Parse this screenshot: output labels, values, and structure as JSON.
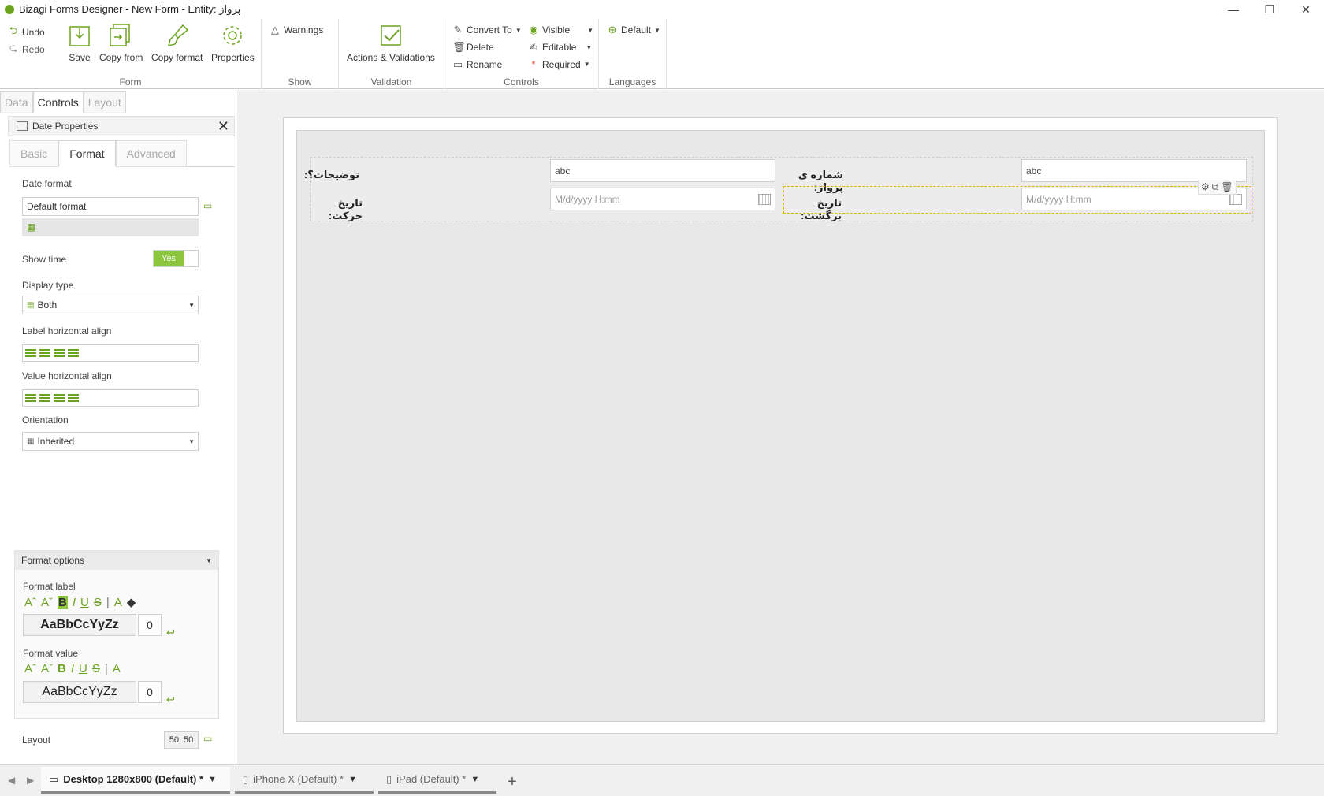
{
  "window": {
    "title": "Bizagi Forms Designer  - New Form - Entity: پرواز",
    "minimize": "—",
    "restore": "❐",
    "close": "✕"
  },
  "ribbon": {
    "form": {
      "undo": "Undo",
      "redo": "Redo",
      "save": "Save",
      "copy_from": "Copy from",
      "copy_format": "Copy format",
      "properties": "Properties",
      "group": "Form"
    },
    "show": {
      "warnings": "Warnings",
      "group": "Show"
    },
    "validation": {
      "actions": "Actions & Validations",
      "group": "Validation"
    },
    "controls": {
      "convert_to": "Convert To",
      "delete": "Delete",
      "rename": "Rename",
      "visible": "Visible",
      "editable": "Editable",
      "required": "Required",
      "group": "Controls"
    },
    "languages": {
      "default": "Default",
      "group": "Languages"
    }
  },
  "left_panel": {
    "tabs": [
      "Data",
      "Controls",
      "Layout"
    ],
    "active_tab": "Controls",
    "header": "Date Properties",
    "prop_tabs": [
      "Basic",
      "Format",
      "Advanced"
    ],
    "active_prop_tab": "Format",
    "date_format_label": "Date format",
    "date_format_value": "Default format",
    "show_time_label": "Show time",
    "show_time_value": "Yes",
    "display_type_label": "Display type",
    "display_type_value": "Both",
    "label_align_label": "Label horizontal align",
    "value_align_label": "Value horizontal align",
    "orientation_label": "Orientation",
    "orientation_value": "Inherited",
    "format_options": "Format options",
    "format_label": "Format label",
    "format_value": "Format value",
    "preview_text": "AaBbCcYyZz",
    "label_size": "0",
    "value_size": "0",
    "layout_label": "Layout",
    "layout_value": "50, 50"
  },
  "form": {
    "fields": {
      "f1_label": "توضیحات؟:",
      "f1_value": "abc",
      "f2_label": "شماره ی پرواز:",
      "f2_value": "abc",
      "f3_label": "تاریخ حرکت:",
      "f3_placeholder": "M/d/yyyy H:mm",
      "f4_label": "تاریخ برگشت:",
      "f4_placeholder": "M/d/yyyy H:mm"
    }
  },
  "bottom_tabs": [
    {
      "label": "Desktop 1280x800 (Default) *",
      "active": true
    },
    {
      "label": "iPhone X (Default) *",
      "active": false
    },
    {
      "label": "iPad (Default) *",
      "active": false
    }
  ],
  "add_tab": "+",
  "colors": {
    "accent": "#8cc63f",
    "accent_dark": "#6aa31d",
    "selection": "#e3b100"
  }
}
